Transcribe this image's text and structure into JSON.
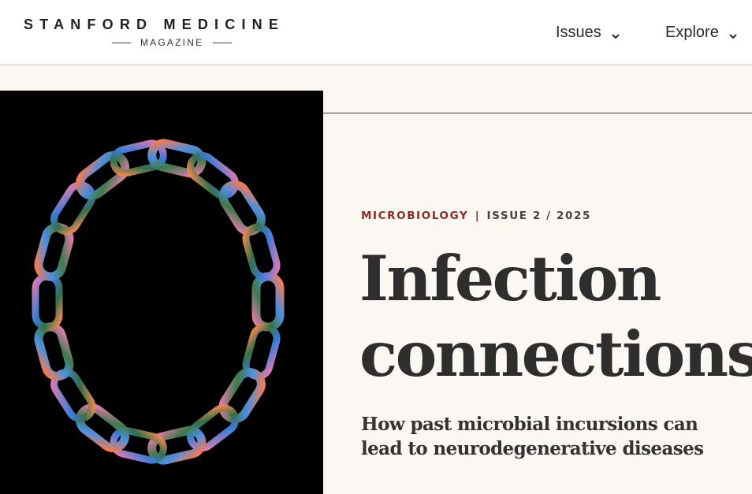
{
  "header": {
    "logo_main": "STANFORD MEDICINE",
    "logo_sub": "MAGAZINE",
    "nav": [
      {
        "label": "Issues"
      },
      {
        "label": "Explore"
      }
    ]
  },
  "hero": {
    "image_icon": "chain-link-illustration",
    "category": "MICROBIOLOGY",
    "separator": "|",
    "issue": "ISSUE 2 / 2025",
    "title": "Infection connections",
    "subtitle": "How past microbial incursions can lead to neurodegenerative diseases"
  },
  "colors": {
    "accent": "#8c2b1d",
    "background": "#fbf7f3",
    "header_bg": "#ffffff",
    "image_bg": "#000000"
  }
}
